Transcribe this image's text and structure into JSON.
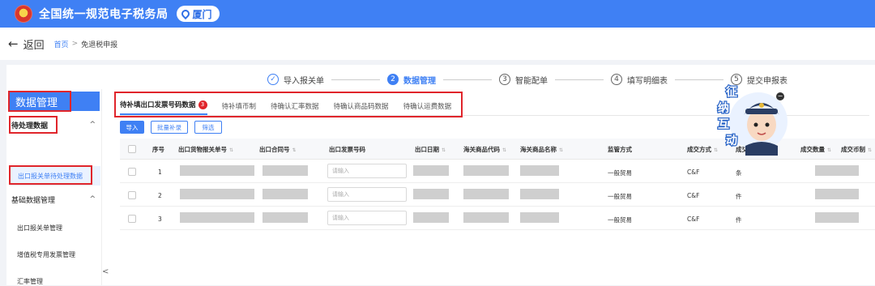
{
  "header": {
    "title": "全国统一规范电子税务局",
    "region": "厦门",
    "brand_color": "#3f80f4"
  },
  "crumbs": {
    "back_label": "返回",
    "home": "首页",
    "separator": ">",
    "current": "免退税申报"
  },
  "steps": [
    {
      "num": "✓",
      "label": "导入报关单"
    },
    {
      "num": "2",
      "label": "数据管理"
    },
    {
      "num": "3",
      "label": "智能配单"
    },
    {
      "num": "4",
      "label": "填写明细表"
    },
    {
      "num": "5",
      "label": "提交申报表"
    }
  ],
  "sidebar": {
    "title": "数据管理",
    "groups": [
      {
        "label": "待处理数据",
        "chevron": "^"
      },
      {
        "label": "基础数据管理",
        "chevron": "^"
      }
    ],
    "items": [
      "出口报关单待处理数据",
      "出口报关单管理",
      "增值税专用发票管理",
      "汇率管理"
    ],
    "collapse": "<"
  },
  "tabs": [
    {
      "label": "待补填出口发票号码数据",
      "badge": "3"
    },
    {
      "label": "待补填币制"
    },
    {
      "label": "待确认汇率数据"
    },
    {
      "label": "待确认商品码数据"
    },
    {
      "label": "待确认运费数据"
    }
  ],
  "toolbar": {
    "import": "导入",
    "batch_fill": "批量补录",
    "filter": "筛选"
  },
  "table": {
    "headers": [
      "序号",
      "出口货物报关单号",
      "出口合同号",
      "出口发票号码",
      "出口日期",
      "海关商品代码",
      "海关商品名称",
      "监管方式",
      "成交方式",
      "成交单位",
      "成交数量",
      "成交币制"
    ],
    "sort_glyph": "⇅",
    "input_placeholder": "请输入",
    "rows": [
      {
        "no": "1",
        "mode": "一般贸易",
        "terms": "C&F",
        "unit": "条"
      },
      {
        "no": "2",
        "mode": "一般贸易",
        "terms": "C&F",
        "unit": "件"
      },
      {
        "no": "3",
        "mode": "一般贸易",
        "terms": "C&F",
        "unit": "件"
      }
    ]
  },
  "mascot": {
    "text": [
      "征",
      "纳",
      "互",
      "动"
    ],
    "close": "−"
  }
}
